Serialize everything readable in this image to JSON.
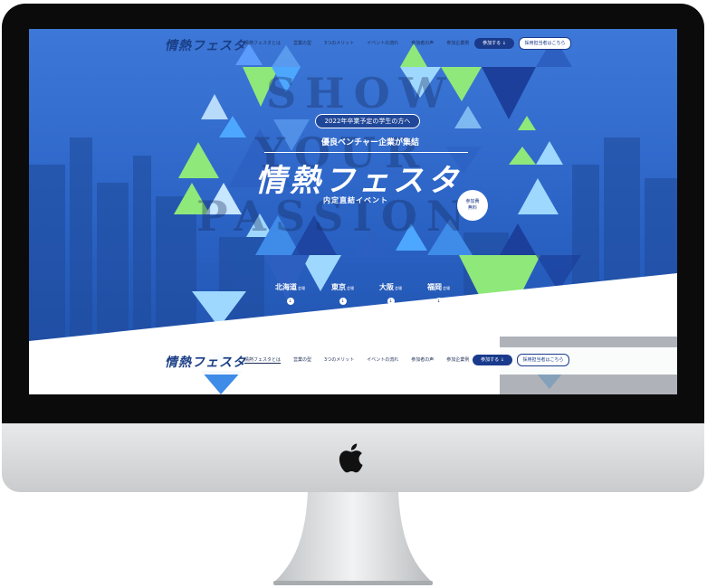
{
  "site": {
    "logo": "情熱フェスタ",
    "nav_items": [
      "情熱フェスタとは",
      "営業の型",
      "3つのメリット",
      "イベントの流れ",
      "参加者の声",
      "参加企業例"
    ],
    "join_button": "参加する ↓",
    "recruit_button": "採用担当者はこちら"
  },
  "hero": {
    "background_words": [
      "SHOW",
      "YOUR",
      "PASSION"
    ],
    "pill": "2022年卒業予定の学生の方へ",
    "tagline": "優良ベンチャー企業が集結",
    "title": "情熱フェスタ",
    "subtitle": "内定直結イベント",
    "badge_line1": "参加費",
    "badge_line2": "無料",
    "venue_suffix": "会場",
    "venues": [
      "北海道",
      "東京",
      "大阪",
      "福岡"
    ],
    "venue_arrow": "↓"
  },
  "colors": {
    "brand_navy": "#1a3a8c",
    "hero_blue": "#2a6ad0",
    "triangle_green": "#8fe87a",
    "triangle_light": "#9fd8ff"
  }
}
